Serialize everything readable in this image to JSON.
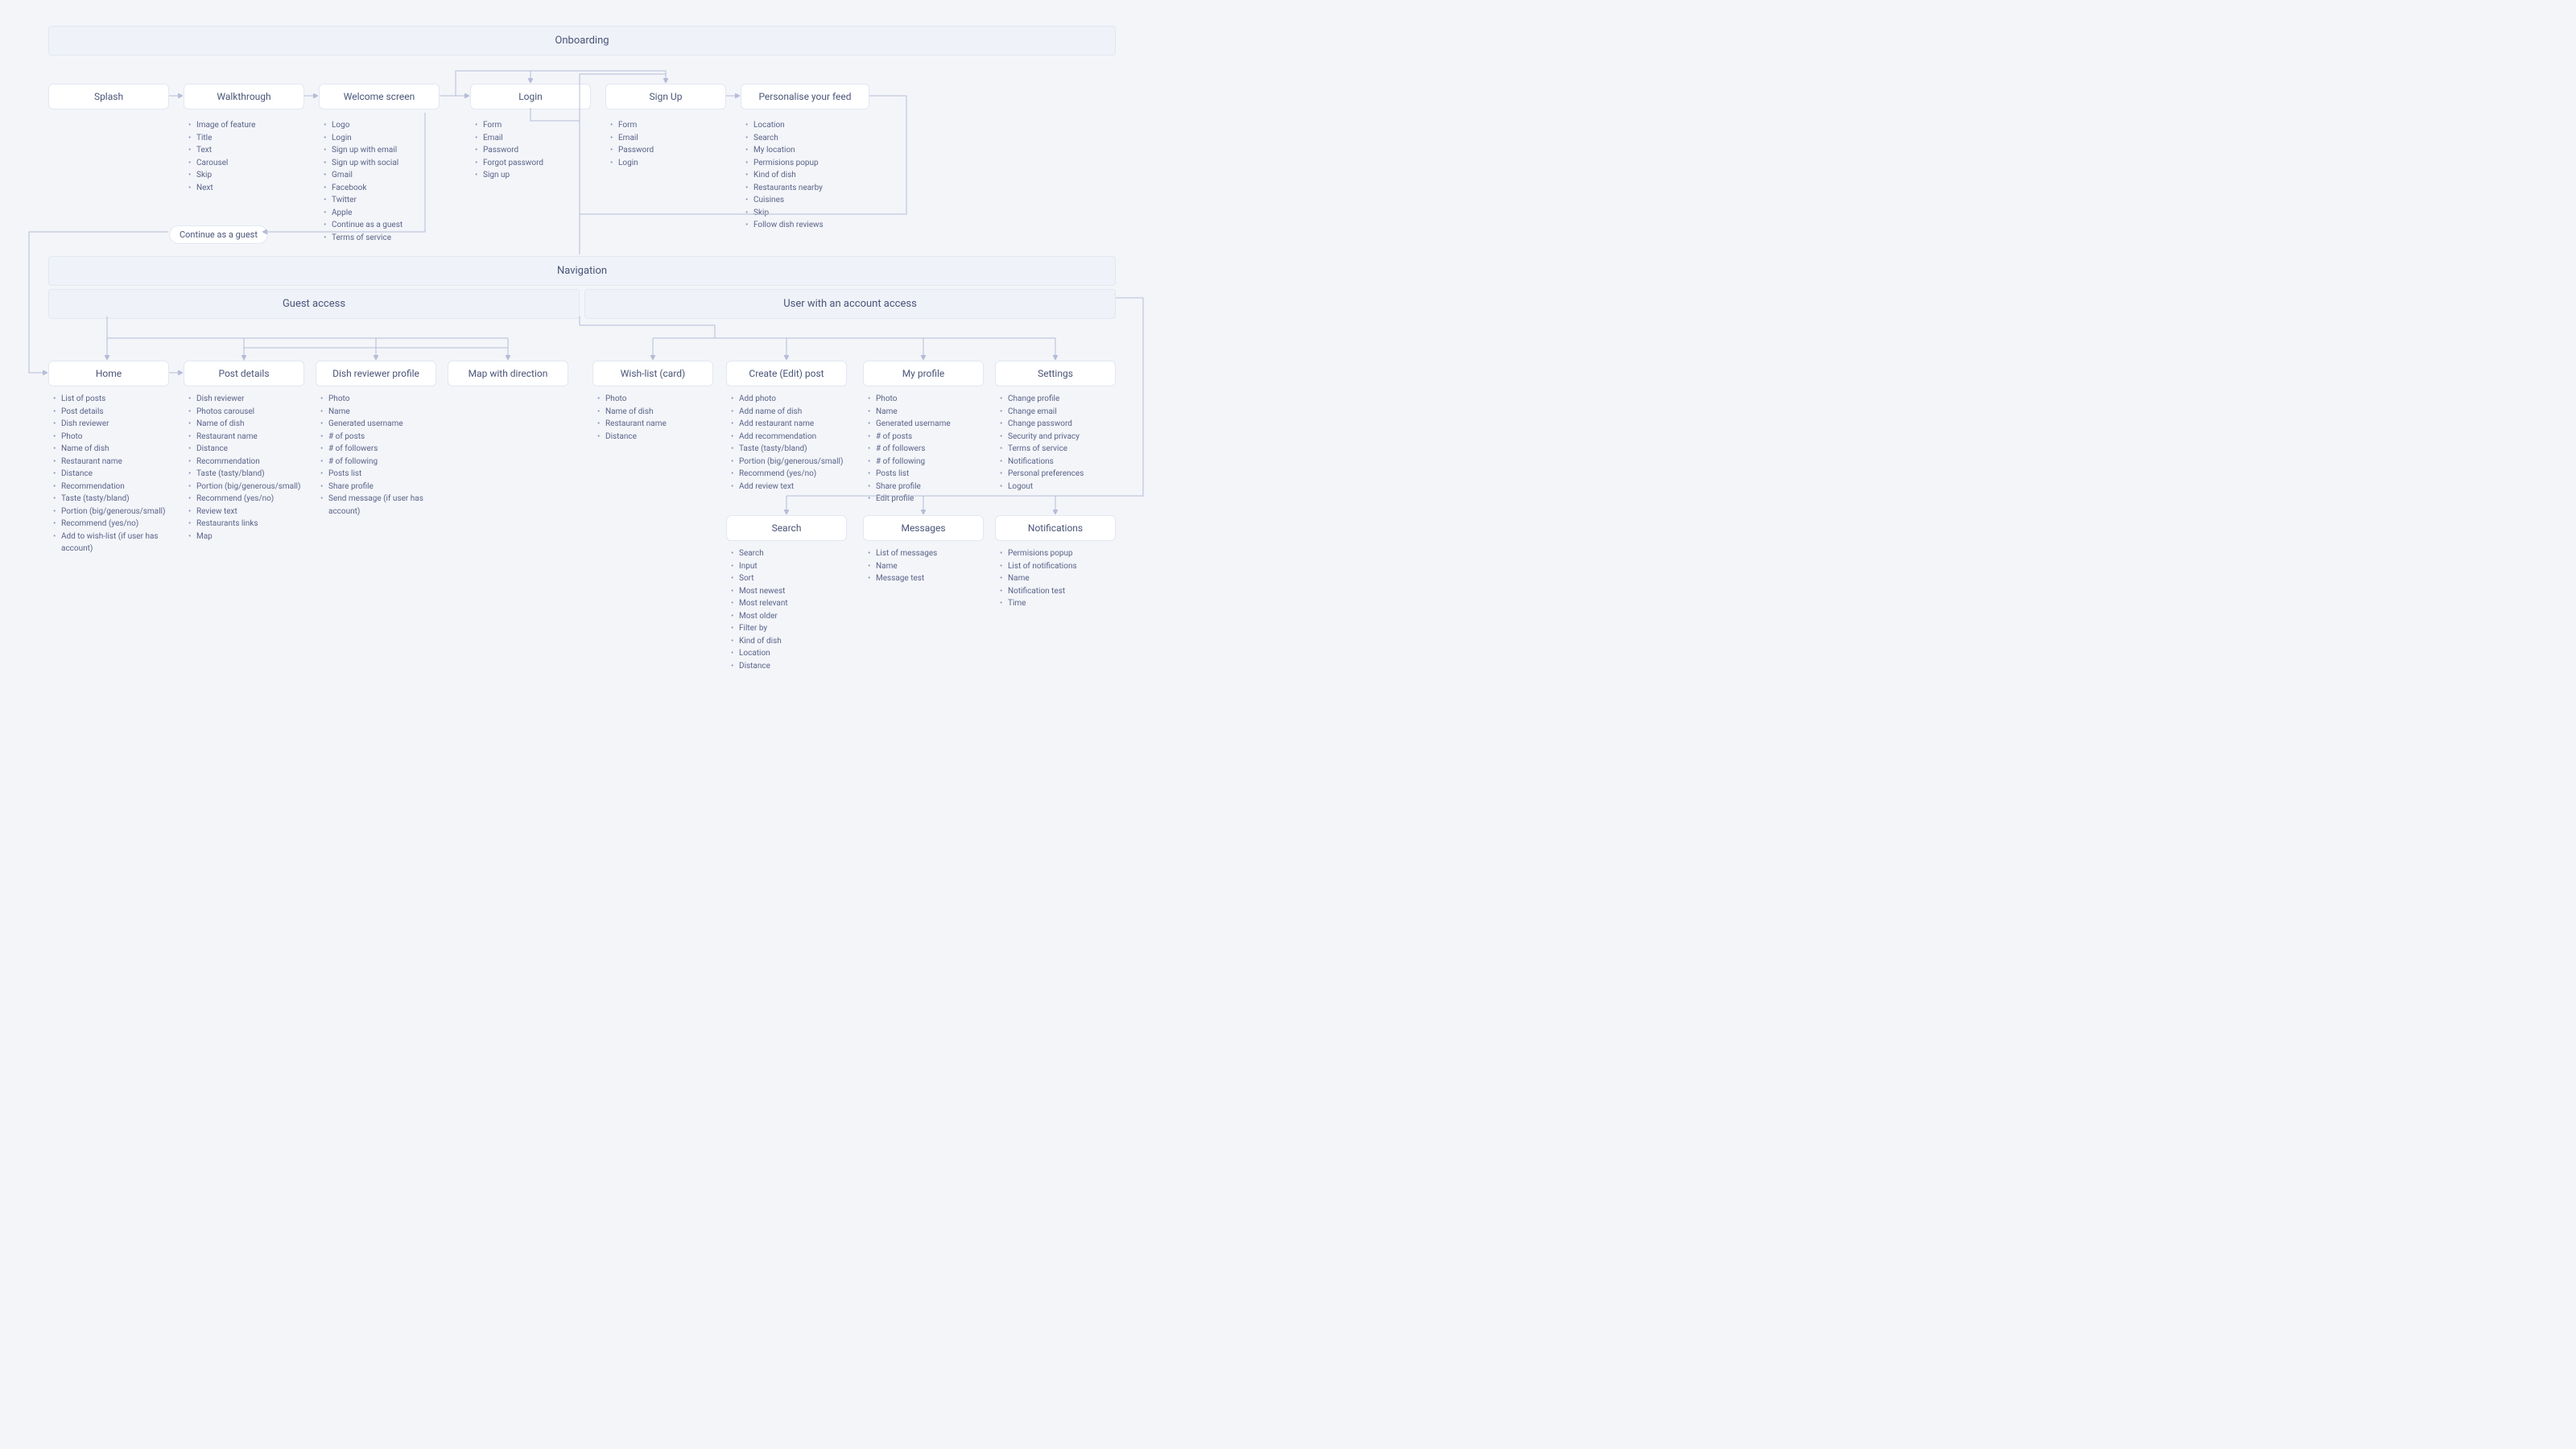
{
  "onboarding": {
    "title": "Onboarding",
    "splash": "Splash",
    "walkthrough": {
      "title": "Walkthrough",
      "items": [
        "Image of feature",
        "Title",
        "Text",
        "Carousel",
        "Skip",
        "Next"
      ]
    },
    "welcome": {
      "title": "Welcome screen",
      "items": [
        "Logo",
        "Login",
        "Sign up with email",
        "Sign up with social",
        "Gmail",
        "Facebook",
        "Twitter",
        "Apple",
        "Continue as a guest",
        "Terms of service"
      ]
    },
    "login": {
      "title": "Login",
      "items": [
        "Form",
        "Email",
        "Password",
        "Forgot password",
        "Sign up"
      ]
    },
    "signup": {
      "title": "Sign Up",
      "items": [
        "Form",
        "Email",
        "Password",
        "Login"
      ]
    },
    "personalise": {
      "title": "Personalise your feed",
      "items": [
        "Location",
        "Search",
        "My location",
        "Permisions popup",
        "Kind of dish",
        "Restaurants nearby",
        "Cuisines",
        "Skip",
        "Follow dish reviews"
      ]
    },
    "guest_pill": "Continue as a guest"
  },
  "navigation": {
    "title": "Navigation",
    "guest": "Guest access",
    "user": "User with an account access",
    "home": {
      "title": "Home",
      "items": [
        "List of posts",
        "Post details",
        "Dish reviewer",
        "Photo",
        "Name of dish",
        "Restaurant name",
        "Distance",
        "Recommendation",
        "Taste (tasty/bland)",
        "Portion (big/generous/small)",
        "Recommend (yes/no)",
        "Add to wish-list (if user has account)"
      ]
    },
    "post": {
      "title": "Post details",
      "items": [
        "Dish reviewer",
        "Photos carousel",
        "Name of dish",
        "Restaurant name",
        "Distance",
        "Recommendation",
        "Taste (tasty/bland)",
        "Portion (big/generous/small)",
        "Recommend (yes/no)",
        "Review text",
        "Restaurants links",
        "Map"
      ]
    },
    "reviewer": {
      "title": "Dish reviewer profile",
      "items": [
        "Photo",
        "Name",
        "Generated username",
        "# of posts",
        "# of followers",
        "# of following",
        "Posts list",
        "Share profile",
        "Send message (if user has account)"
      ]
    },
    "map": {
      "title": "Map with direction"
    },
    "wishlist": {
      "title": "Wish-list (card)",
      "items": [
        "Photo",
        "Name of dish",
        "Restaurant name",
        "Distance"
      ]
    },
    "create": {
      "title": "Create (Edit) post",
      "items": [
        "Add photo",
        "Add name of dish",
        "Add restaurant name",
        "Add recommendation",
        "Taste (tasty/bland)",
        "Portion (big/generous/small)",
        "Recommend (yes/no)",
        "Add review text"
      ]
    },
    "profile": {
      "title": "My profile",
      "items": [
        "Photo",
        "Name",
        "Generated username",
        "# of posts",
        "# of followers",
        "# of following",
        "Posts list",
        "Share profile",
        "Edit profile"
      ]
    },
    "settings": {
      "title": "Settings",
      "items": [
        "Change profile",
        "Change email",
        "Change password",
        "Security and privacy",
        "Terms of service",
        "Notifications",
        "Personal preferences",
        "Logout"
      ]
    },
    "search": {
      "title": "Search",
      "items": [
        "Search",
        "Input",
        "Sort",
        "Most newest",
        "Most relevant",
        "Most older",
        "Filter by",
        "Kind of dish",
        "Location",
        "Distance"
      ]
    },
    "messages": {
      "title": "Messages",
      "items": [
        "List of messages",
        "Name",
        "Message test"
      ]
    },
    "notifications": {
      "title": "Notifications",
      "items": [
        "Permisions popup",
        "List of notifications",
        "Name",
        "Notification test",
        "Time"
      ]
    }
  }
}
